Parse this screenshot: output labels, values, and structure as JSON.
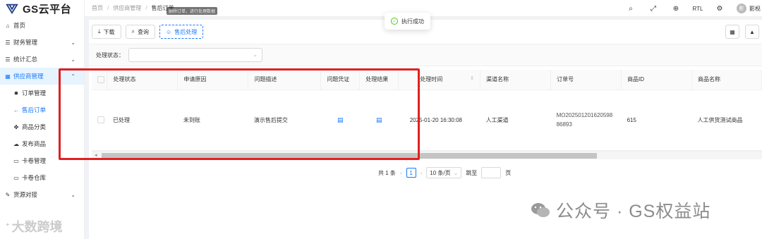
{
  "app": {
    "logo_text": "GS云平台"
  },
  "sidebar": {
    "items": [
      {
        "label": "首页",
        "icon": "home-icon"
      },
      {
        "label": "财务管理",
        "icon": "list-icon",
        "chevron": "⌄"
      },
      {
        "label": "统计汇总",
        "icon": "list-icon",
        "chevron": "⌄"
      },
      {
        "label": "供应商管理",
        "icon": "list-icon",
        "chevron": "⌃"
      }
    ],
    "sub_items": [
      {
        "label": "订单管理",
        "icon": "gear-icon"
      },
      {
        "label": "售后订单",
        "icon": "back-arrow-icon"
      },
      {
        "label": "商品分类",
        "icon": "category-icon"
      },
      {
        "label": "发布商品",
        "icon": "cloud-upload-icon"
      },
      {
        "label": "卡卷管理",
        "icon": "card-icon"
      },
      {
        "label": "卡卷仓库",
        "icon": "card-icon"
      }
    ],
    "last_item": {
      "label": "货源对接",
      "icon": "plug-icon",
      "chevron": "⌄"
    },
    "watermark": "大数跨境"
  },
  "header": {
    "breadcrumb": [
      "首页",
      "供应商管理",
      "售后订单"
    ],
    "tooltip": "删除订单，进行处理数据",
    "rtl_label": "RTL",
    "avatar_text": "影",
    "username": "影枧"
  },
  "toast": {
    "message": "执行成功"
  },
  "toolbar": {
    "download_label": "下载",
    "query_label": "查询",
    "aftersale_label": "售后处理"
  },
  "filter": {
    "label": "处理状态：",
    "placeholder": ""
  },
  "table": {
    "columns": [
      "处理状态",
      "申请原因",
      "问题描述",
      "问题凭证",
      "处理结果",
      "处理时间",
      "渠道名称",
      "订单号",
      "商品ID",
      "商品名称"
    ],
    "rows": [
      {
        "status": "已处理",
        "reason": "未到账",
        "description": "演示售后提交",
        "time": "2025-01-20 16:30:08",
        "channel": "人工渠道",
        "order_no": "MO202501201620598 86893",
        "product_id": "615",
        "product_name": "人工供货测试商品"
      }
    ]
  },
  "pagination": {
    "total": "共 1 条",
    "current_page": "1",
    "page_size": "10 条/页",
    "jump_label": "跳至",
    "page_suffix": "页"
  },
  "watermark_right": "公众号 · GS权益站",
  "colors": {
    "accent": "#1677ff",
    "success": "#52c41a",
    "annotation": "#e02020"
  }
}
